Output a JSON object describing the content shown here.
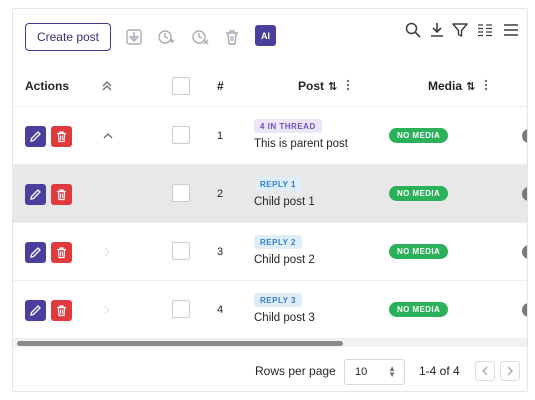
{
  "toolbar": {
    "create_label": "Create post",
    "ai_label": "AI",
    "icons": [
      "import-icon",
      "schedule-add-icon",
      "schedule-cancel-icon",
      "trash-icon",
      "search-icon",
      "download-icon",
      "filter-icon",
      "columns-icon",
      "menu-icon"
    ]
  },
  "header": {
    "actions": "Actions",
    "number": "#",
    "post": "Post",
    "media": "Media",
    "sort_glyph": "⇅"
  },
  "rows": [
    {
      "num": "1",
      "badge": "4 IN THREAD",
      "badge_type": "parent",
      "title": "This is parent post",
      "media": "NO MEDIA",
      "expander": "expanded"
    },
    {
      "num": "2",
      "badge": "REPLY 1",
      "badge_type": "reply",
      "title": "Child post 1",
      "media": "NO MEDIA",
      "expander": "child",
      "highlight": true
    },
    {
      "num": "3",
      "badge": "REPLY 2",
      "badge_type": "reply",
      "title": "Child post 2",
      "media": "NO MEDIA",
      "expander": "child"
    },
    {
      "num": "4",
      "badge": "REPLY 3",
      "badge_type": "reply",
      "title": "Child post 3",
      "media": "NO MEDIA",
      "expander": "child"
    }
  ],
  "footer": {
    "rows_per_page_label": "Rows per page",
    "rows_per_page_value": "10",
    "range": "1-4 of 4"
  },
  "colors": {
    "primary": "#4b3f9e",
    "danger": "#e03a3e",
    "success": "#2ab15a"
  }
}
